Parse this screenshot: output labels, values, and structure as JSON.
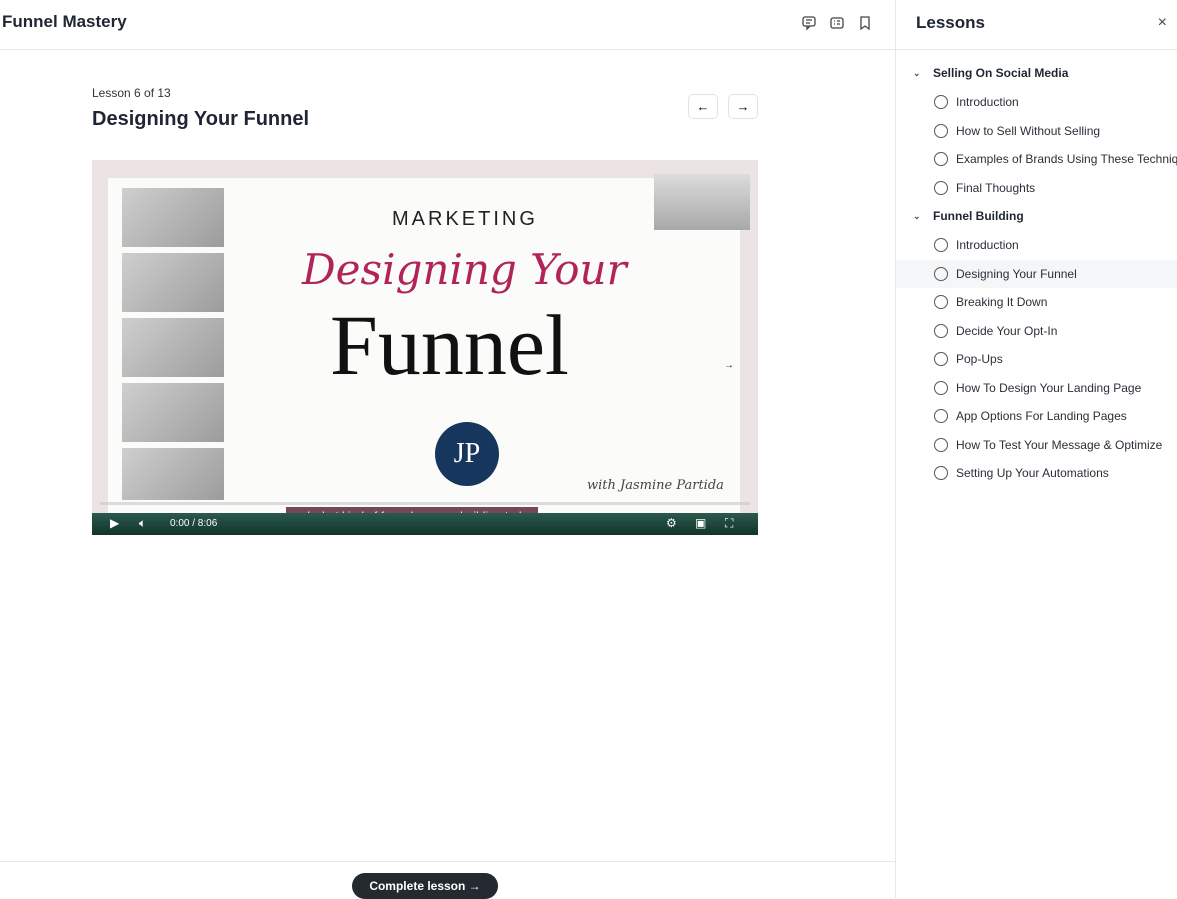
{
  "header": {
    "title": "Funnel Mastery",
    "icons": [
      "comment-icon",
      "notes-icon",
      "bookmark-icon"
    ]
  },
  "lesson": {
    "count": "Lesson 6 of 13",
    "title": "Designing Your Funnel",
    "prev": "←",
    "next": "→"
  },
  "video": {
    "heading": "MARKETING",
    "script_title": "Designing Your",
    "big_title": "Funnel",
    "logo": "JP",
    "signature": "with Jasmine Partida",
    "time": "0:00 / 8:06",
    "caption": "and what kind of funnel you are building today",
    "progress": 0
  },
  "footer": {
    "complete_label": "Complete lesson →"
  },
  "sidebar": {
    "title": "Lessons",
    "close": "×",
    "sections": [
      {
        "title": "Selling On Social Media",
        "items": [
          "Introduction",
          "How to Sell Without Selling",
          "Examples of Brands Using These Techniques",
          "Final Thoughts"
        ]
      },
      {
        "title": "Funnel Building",
        "items": [
          "Introduction",
          "Designing Your Funnel",
          "Breaking It Down",
          "Decide Your Opt-In",
          "Pop-Ups",
          "How To Design Your Landing Page",
          "App Options For Landing Pages",
          "How To Test Your Message & Optimize",
          "Setting Up Your Automations"
        ]
      }
    ],
    "active": "Designing Your Funnel"
  }
}
